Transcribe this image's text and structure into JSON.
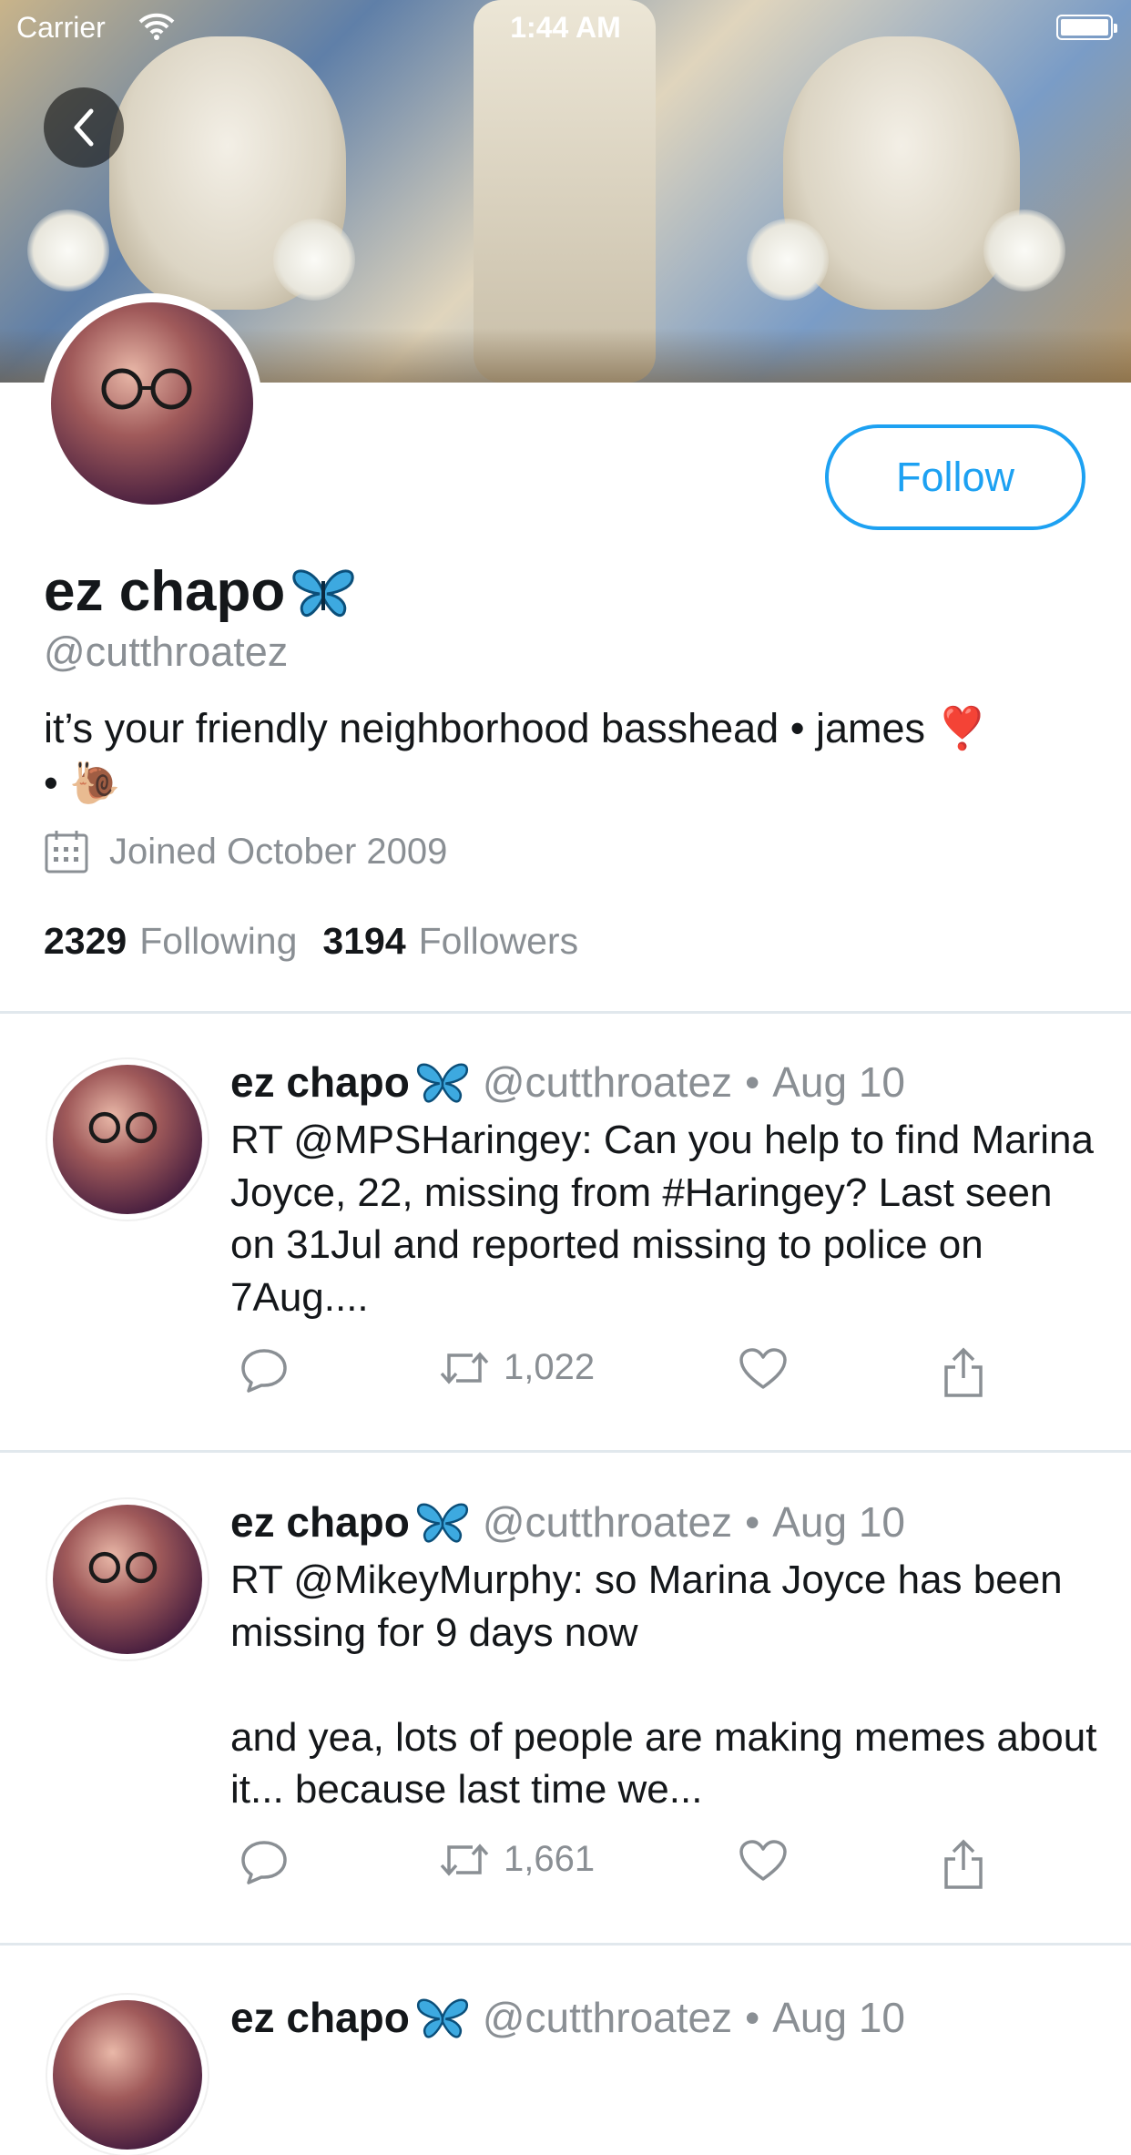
{
  "status_bar": {
    "carrier": "Carrier",
    "time": "1:44 AM"
  },
  "profile": {
    "name": "ez chapo",
    "name_emoji": "butterfly-emoji",
    "handle": "@cutthroatez",
    "bio_line1": "it’s your friendly neighborhood basshead • james ❣️",
    "bio_line2": "• 🐌",
    "joined": "Joined October 2009",
    "following_count": "2329",
    "following_label": "Following",
    "followers_count": "3194",
    "followers_label": "Followers",
    "follow_button": "Follow"
  },
  "colors": {
    "accent": "#1da1f2",
    "secondary_text": "#8a8f94",
    "divider": "#e1e8ed"
  },
  "tweets": [
    {
      "name": "ez chapo",
      "handle": "@cutthroatez",
      "date": "Aug 10",
      "text": "RT @MPSHaringey: Can you help to find Marina Joyce, 22, missing from #Haringey? Last seen on 31Jul and reported missing to police on 7Aug....",
      "retweets": "1,022"
    },
    {
      "name": "ez chapo",
      "handle": "@cutthroatez",
      "date": "Aug 10",
      "text": "RT @MikeyMurphy: so Marina Joyce has been missing for 9 days now\n\nand yea, lots of people are making memes about it... because last time we...",
      "retweets": "1,661"
    },
    {
      "name": "ez chapo",
      "handle": "@cutthroatez",
      "date": "Aug 10"
    }
  ]
}
